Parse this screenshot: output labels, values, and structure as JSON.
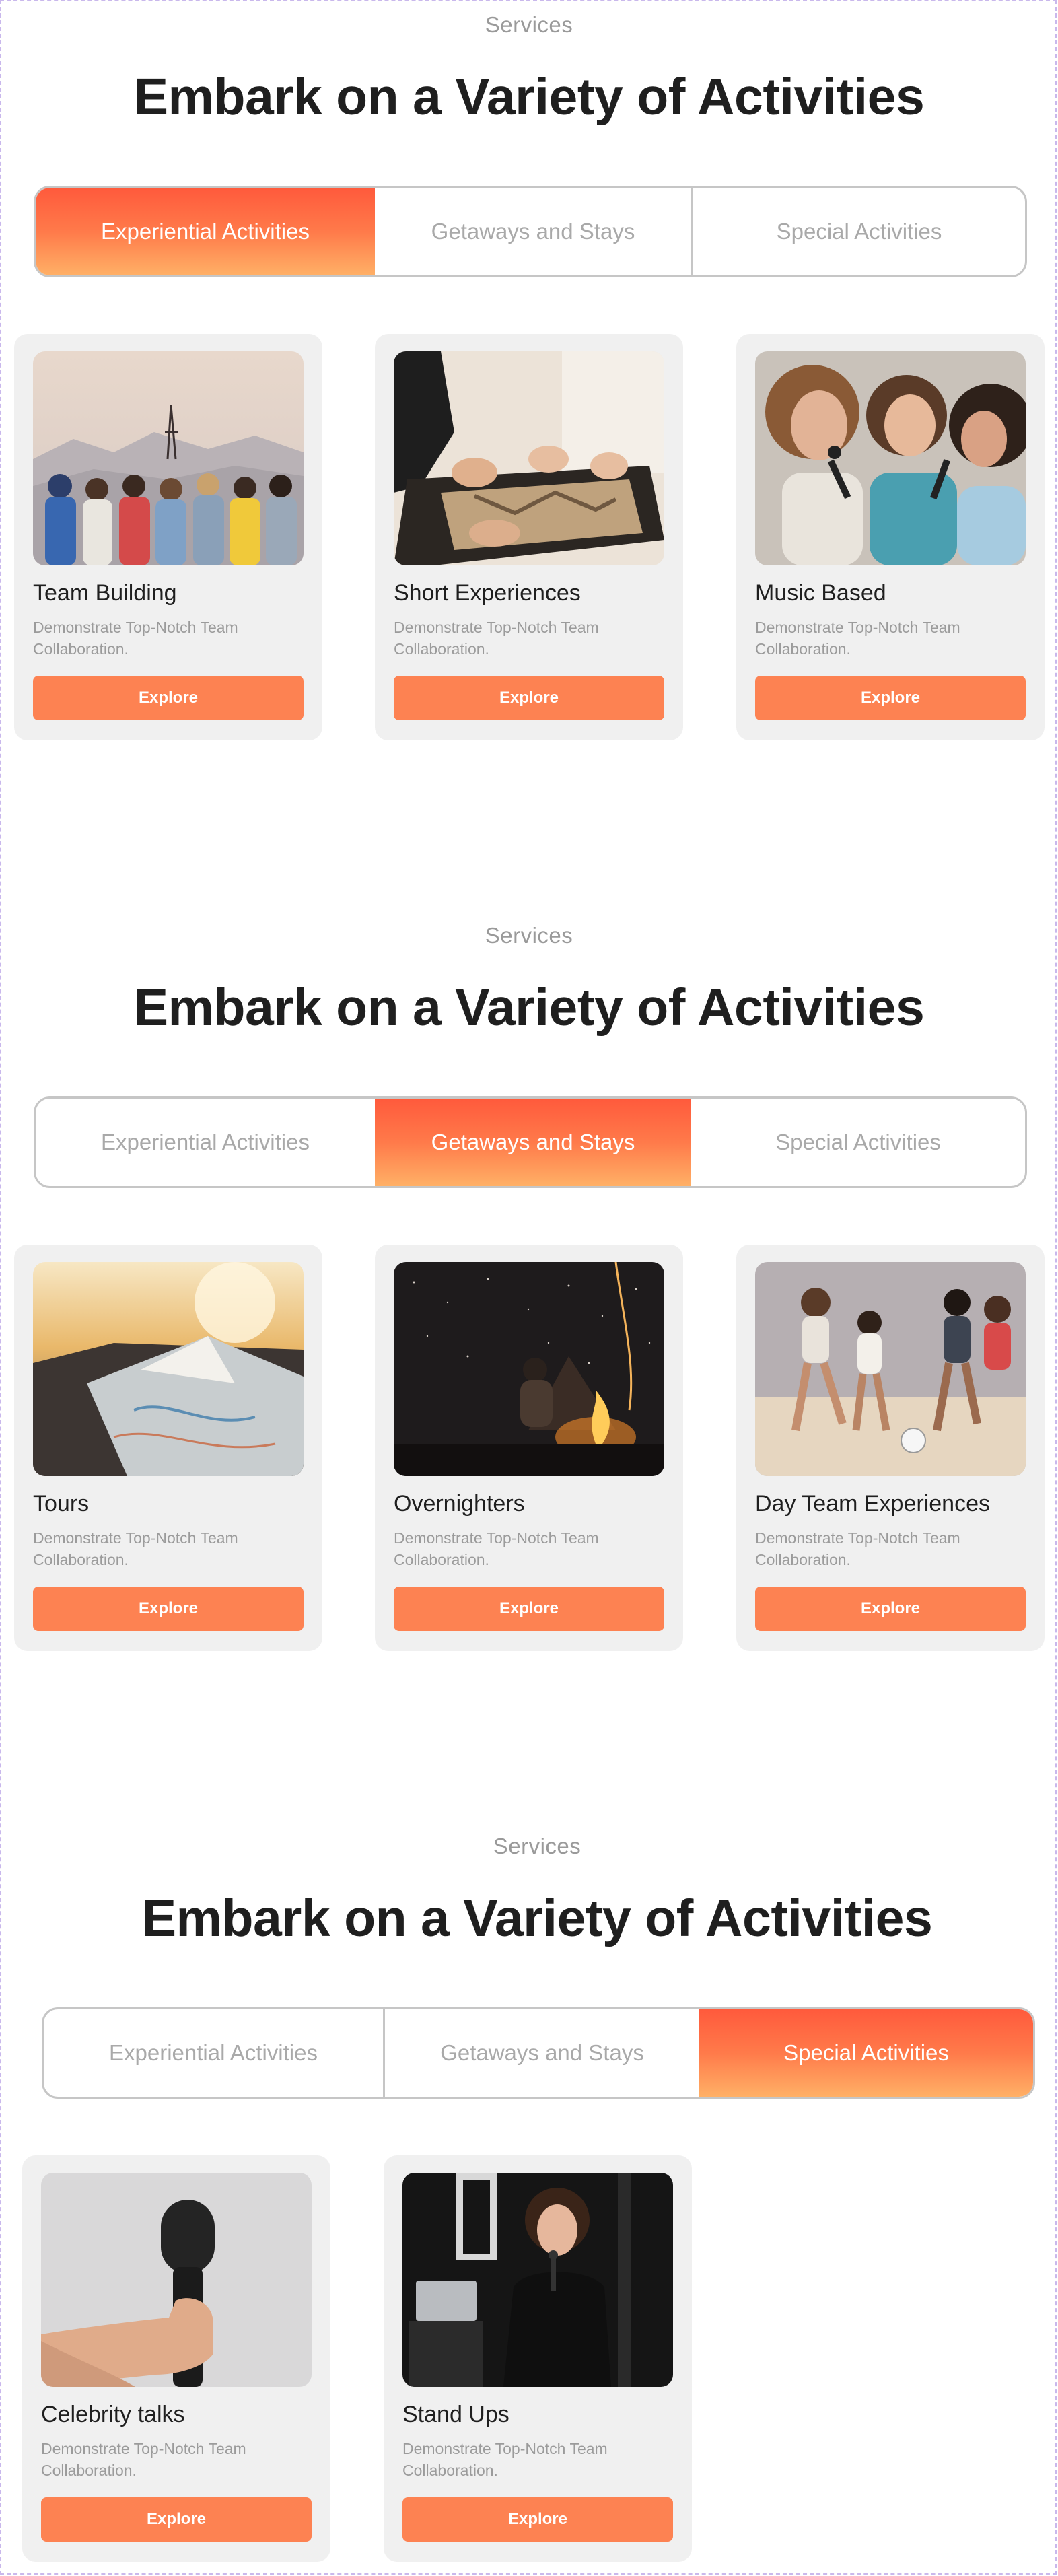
{
  "sections": [
    {
      "eyebrow": "Services",
      "title": "Embark on a Variety of Activities",
      "tabs": [
        "Experiential Activities",
        "Getaways and Stays",
        "Special Activities"
      ],
      "active_tab": 0,
      "cards": [
        {
          "title": "Team Building",
          "description": "Demonstrate Top-Notch Team Collaboration.",
          "button": "Explore",
          "image": "group-friends-mountain-photo"
        },
        {
          "title": "Short Experiences",
          "description": "Demonstrate Top-Notch Team Collaboration.",
          "button": "Explore",
          "image": "hands-puzzle-photo"
        },
        {
          "title": "Music Based",
          "description": "Demonstrate Top-Notch Team Collaboration.",
          "button": "Explore",
          "image": "women-singing-karaoke-photo"
        }
      ]
    },
    {
      "eyebrow": "Services",
      "title": "Embark on a Variety of Activities",
      "tabs": [
        "Experiential Activities",
        "Getaways and Stays",
        "Special Activities"
      ],
      "active_tab": 1,
      "cards": [
        {
          "title": "Tours",
          "description": "Demonstrate Top-Notch Team Collaboration.",
          "button": "Explore",
          "image": "map-on-dashboard-photo"
        },
        {
          "title": "Overnighters",
          "description": "Demonstrate Top-Notch Team Collaboration.",
          "button": "Explore",
          "image": "campfire-night-photo"
        },
        {
          "title": "Day Team Experiences",
          "description": "Demonstrate Top-Notch Team Collaboration.",
          "button": "Explore",
          "image": "beach-football-photo"
        }
      ]
    },
    {
      "eyebrow": "Services",
      "title": "Embark on a Variety of Activities",
      "tabs": [
        "Experiential Activities",
        "Getaways and Stays",
        "Special Activities"
      ],
      "active_tab": 2,
      "cards": [
        {
          "title": "Celebrity talks",
          "description": "Demonstrate Top-Notch Team Collaboration.",
          "button": "Explore",
          "image": "hand-holding-microphone-photo"
        },
        {
          "title": "Stand Ups",
          "description": "Demonstrate Top-Notch Team Collaboration.",
          "button": "Explore",
          "image": "woman-on-stage-photo"
        }
      ]
    }
  ],
  "colors": {
    "accent": "#fd8252",
    "tab_gradient_top": "#ff5a3c",
    "tab_gradient_bottom": "#ffb066",
    "card_bg": "#f0f0f0",
    "muted_text": "#9b9b9b"
  }
}
